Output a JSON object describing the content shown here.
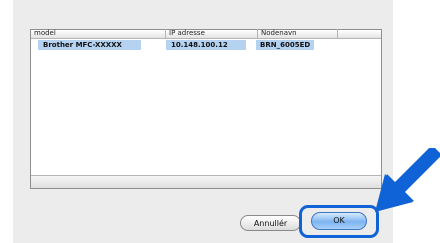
{
  "table": {
    "columns": [
      "model",
      "IP adresse",
      "Nodenavn"
    ],
    "rows": [
      [
        "Brother MFC-XXXXX",
        "10.148.100.12",
        "BRN_6005ED"
      ]
    ]
  },
  "buttons": {
    "cancel_label": "Annullér",
    "ok_label": "OK"
  },
  "colors": {
    "selection": "#b6d2f1",
    "highlight": "#0f63d6"
  }
}
